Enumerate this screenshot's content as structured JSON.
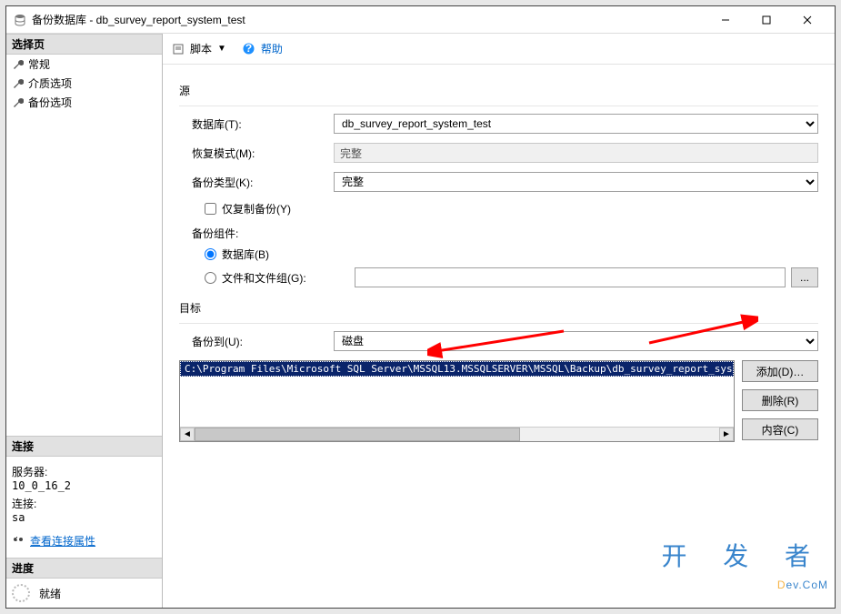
{
  "window": {
    "title": "备份数据库 - db_survey_report_system_test"
  },
  "sidebar": {
    "select_header": "选择页",
    "items": [
      {
        "label": "常规"
      },
      {
        "label": "介质选项"
      },
      {
        "label": "备份选项"
      }
    ],
    "conn_header": "连接",
    "server_label": "服务器:",
    "server_value": "10_0_16_2",
    "conn_label": "连接:",
    "conn_value": "sa",
    "view_conn_link": "查看连接属性",
    "progress_header": "进度",
    "progress_status": "就绪"
  },
  "toolbar": {
    "script_label": "脚本",
    "help_label": "帮助"
  },
  "form": {
    "source_group": "源",
    "database_label": "数据库(T):",
    "database_value": "db_survey_report_system_test",
    "recovery_label": "恢复模式(M):",
    "recovery_value": "完整",
    "backup_type_label": "备份类型(K):",
    "backup_type_value": "完整",
    "copy_only_label": "仅复制备份(Y)",
    "component_group": "备份组件:",
    "radio_db_label": "数据库(B)",
    "radio_files_label": "文件和文件组(G):",
    "dest_group": "目标",
    "backup_to_label": "备份到(U):",
    "backup_to_value": "磁盘",
    "dest_path": "C:\\Program Files\\Microsoft SQL Server\\MSSQL13.MSSQLSERVER\\MSSQL\\Backup\\db_survey_report_system_test.b",
    "add_btn": "添加(D)…",
    "remove_btn": "删除(R)",
    "contents_btn": "内容(C)",
    "browse_btn": "..."
  },
  "watermark": {
    "cn": "开 发 者",
    "en_pre": "D",
    "en_rest": "ev.CoM"
  }
}
